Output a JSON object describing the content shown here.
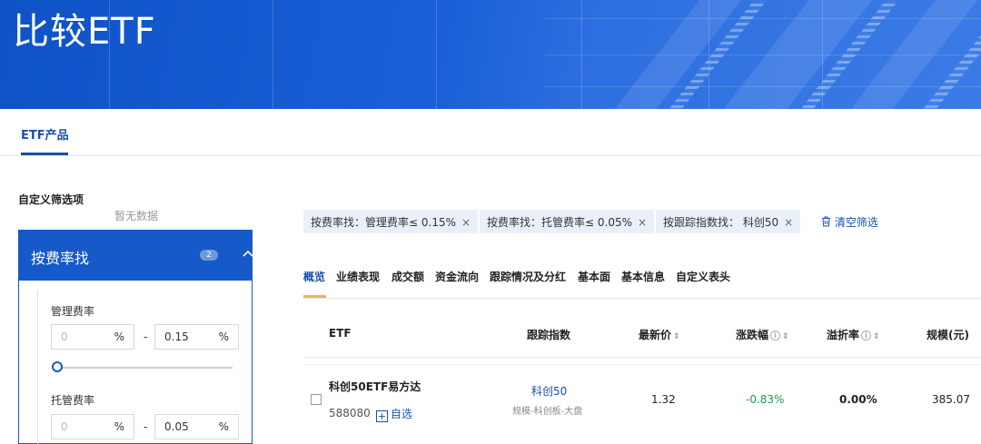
{
  "banner": {
    "title": "比较ETF"
  },
  "tabs": {
    "etf_products": "ETF产品"
  },
  "filters_panel": {
    "custom_title": "自定义筛选项",
    "no_data": "暂无数据",
    "group_title": "按费率找",
    "group_badge": "2",
    "mgmt_fee": {
      "label": "管理费率",
      "min_placeholder": "0",
      "max_value": "0.15",
      "unit": "%",
      "separator": "-"
    },
    "custody_fee": {
      "label": "托管费率",
      "min_placeholder": "0",
      "max_value": "0.05",
      "unit": "%",
      "separator": "-"
    }
  },
  "chips": [
    {
      "label": "按费率找：管理费率≤ 0.15%"
    },
    {
      "label": "按费率找：托管费率≤ 0.05%"
    },
    {
      "label": "按跟踪指数找： 科创50"
    }
  ],
  "chip_close": "×",
  "clear_filters": "清空筛选",
  "data_tabs": [
    "概览",
    "业绩表现",
    "成交额",
    "资金流向",
    "跟踪情况及分红",
    "基本面",
    "基本信息",
    "自定义表头"
  ],
  "table": {
    "headers": {
      "etf": "ETF",
      "index": "跟踪指数",
      "price": "最新价",
      "change": "涨跌幅",
      "premium": "溢折率",
      "size": "规模(元)"
    },
    "rows": [
      {
        "name": "科创50ETF易方达",
        "code": "588080",
        "watch_label": "自选",
        "index_name": "科创50",
        "index_tags": "规模-科创板-大盘",
        "price": "1.32",
        "change": "-0.83%",
        "premium": "0.00%",
        "size": "385.07"
      }
    ]
  },
  "colors": {
    "brand": "#1659c8",
    "link": "#1a4fa8",
    "down": "#1f9a4c",
    "chip_bg": "#e9f0fa"
  }
}
